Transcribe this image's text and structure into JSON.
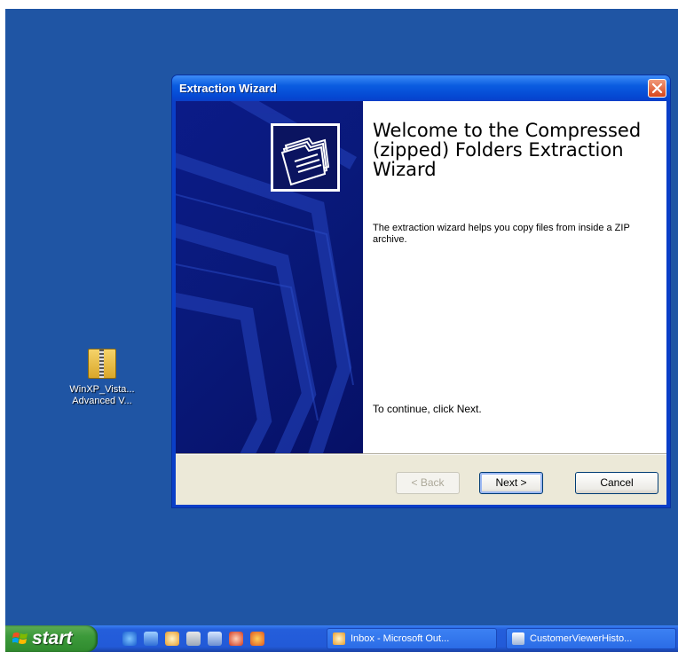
{
  "desktop": {
    "icon": {
      "name": "zip-folder-icon",
      "label_line1": "WinXP_Vista...",
      "label_line2": "Advanced V..."
    }
  },
  "dialog": {
    "title": "Extraction Wizard",
    "heading": "Welcome to the Compressed (zipped) Folders Extraction Wizard",
    "description": "The extraction wizard helps you copy files from inside a ZIP archive.",
    "continue_text": "To continue, click Next.",
    "buttons": {
      "back": "< Back",
      "next": "Next >",
      "cancel": "Cancel"
    }
  },
  "taskbar": {
    "start_label": "start",
    "quick_launch": [
      "ie-icon",
      "app-icon",
      "clock-icon",
      "network-icon",
      "document-icon",
      "media-icon",
      "firefox-icon"
    ],
    "tasks": [
      {
        "label": "Inbox - Microsoft Out...",
        "icon": "outlook-icon"
      },
      {
        "label": "CustomerViewerHisto...",
        "icon": "window-icon"
      }
    ]
  },
  "colors": {
    "desktop": "#1f55a4",
    "titlebar": "#0a5ce0",
    "start_button": "#3c9a3a"
  }
}
